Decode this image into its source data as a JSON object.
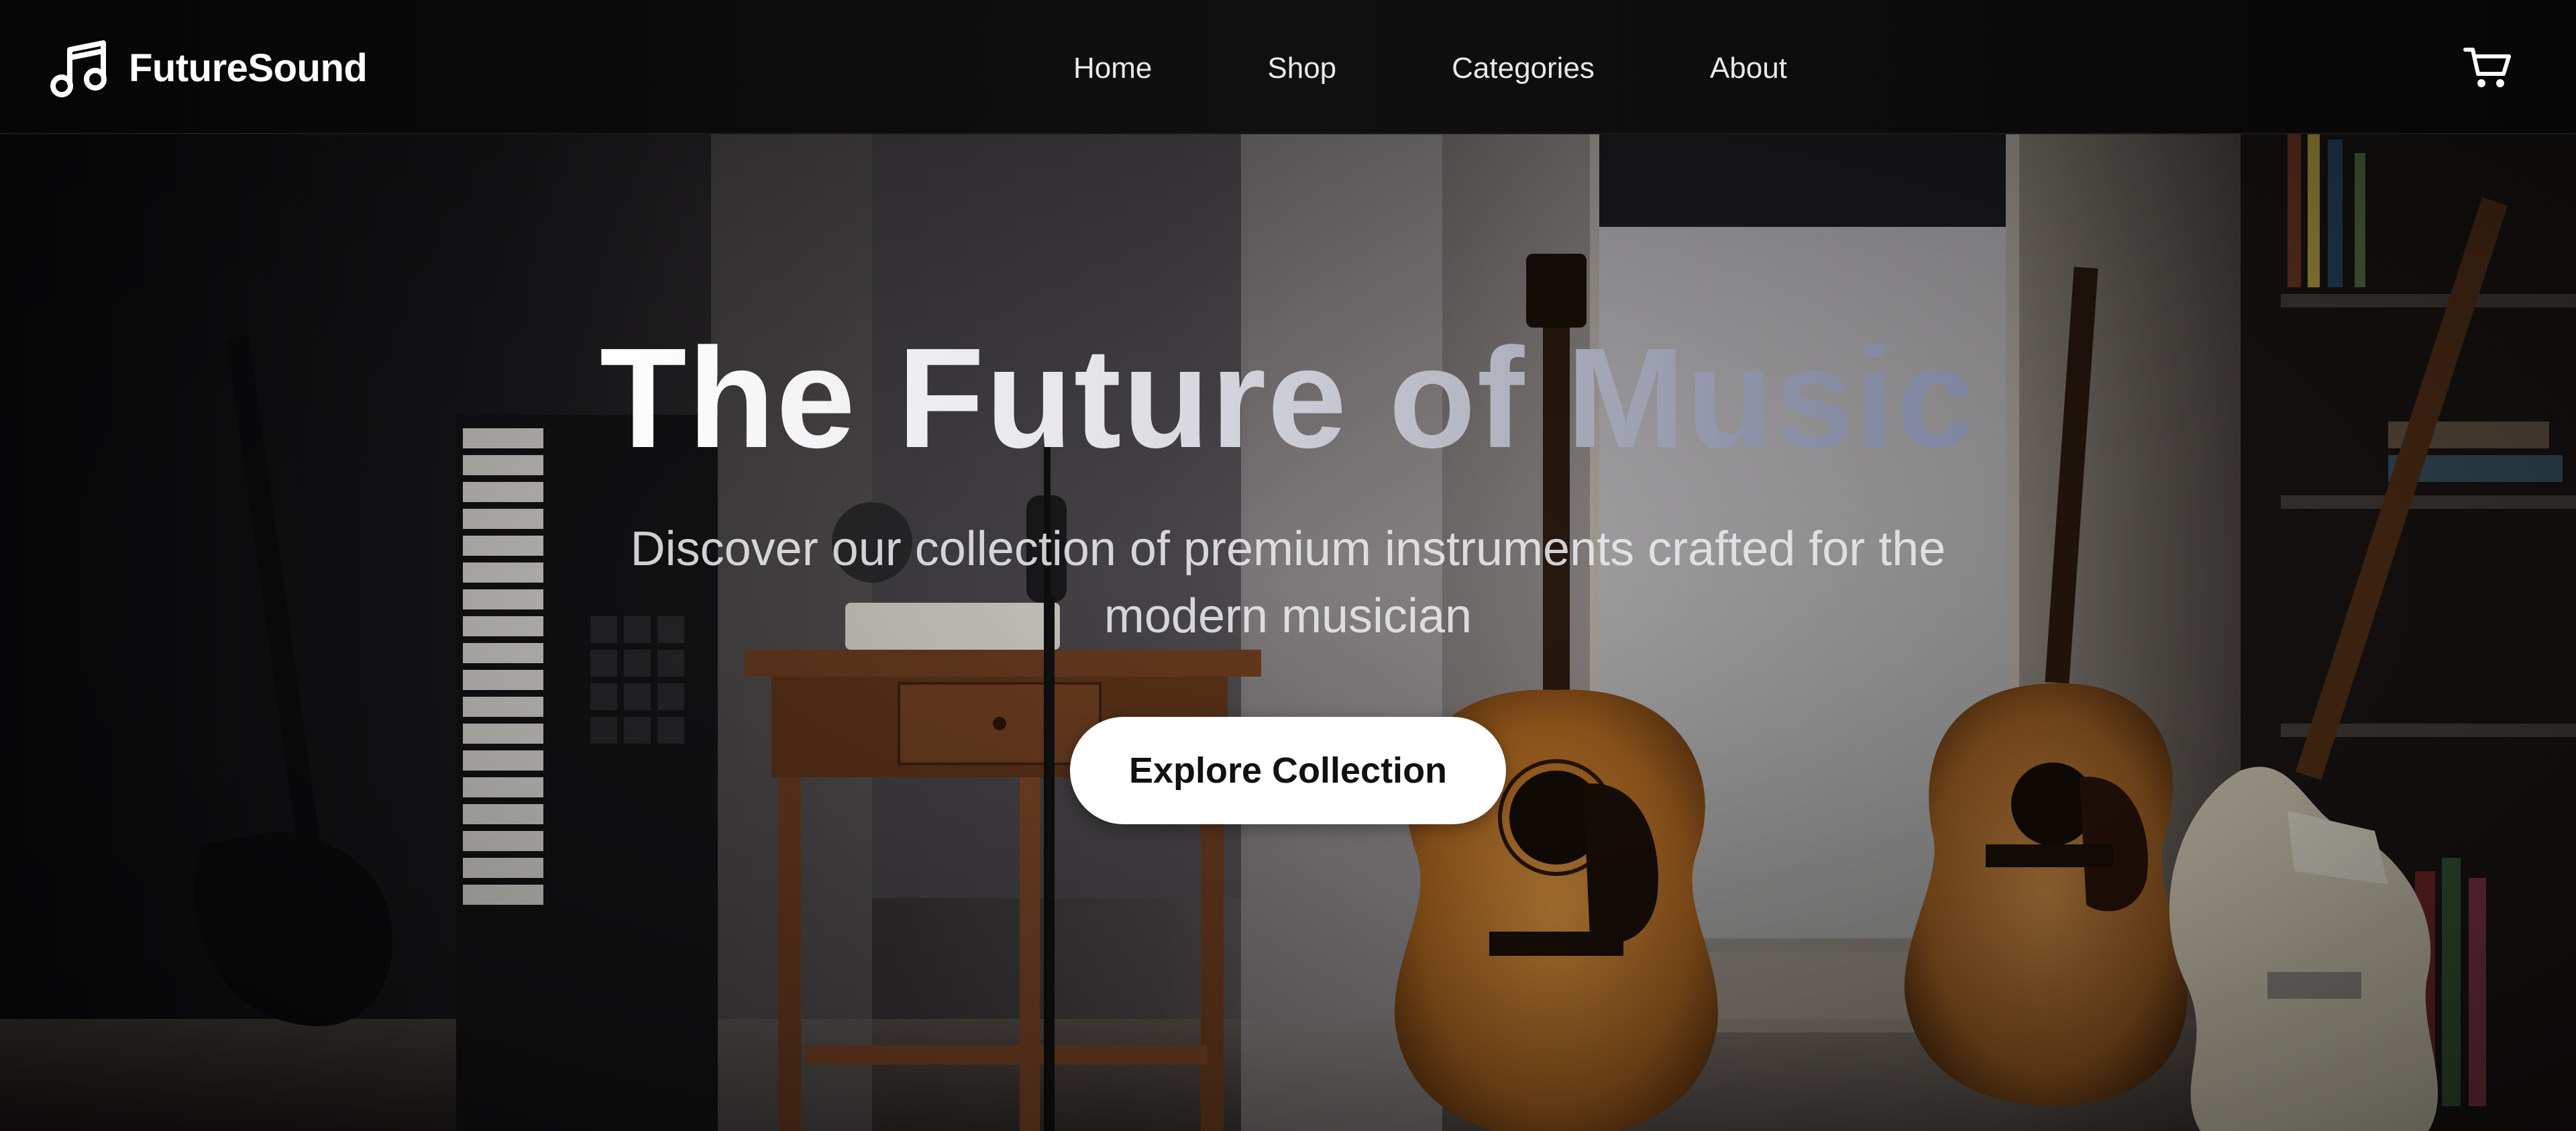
{
  "brand": {
    "name": "FutureSound",
    "icon": "music-note-icon"
  },
  "nav": {
    "items": [
      {
        "label": "Home"
      },
      {
        "label": "Shop"
      },
      {
        "label": "Categories"
      },
      {
        "label": "About"
      }
    ],
    "cart_icon": "shopping-cart-icon"
  },
  "hero": {
    "title": "The Future of Music",
    "subtitle": "Discover our collection of premium instruments crafted for the modern musician",
    "cta_label": "Explore Collection",
    "background": "music-room-with-guitars-and-keyboard"
  },
  "colors": {
    "navbar_bg": "#0a0a0a",
    "cta_bg": "#ffffff",
    "cta_text": "#111111",
    "title_gradient_start": "#ffffff",
    "title_gradient_end": "#7f84a0"
  }
}
